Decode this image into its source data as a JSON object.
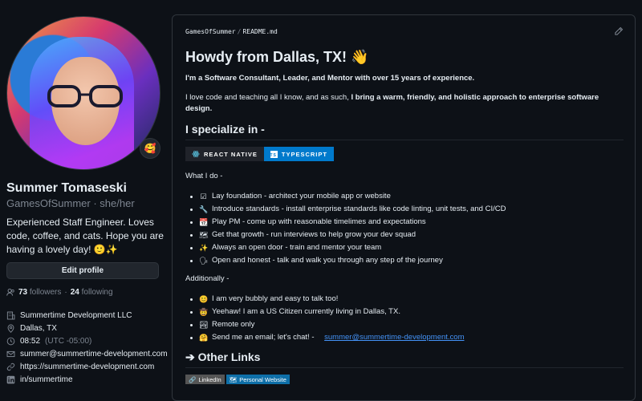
{
  "profile": {
    "name": "Summer Tomaseski",
    "login_line": "GamesOfSummer · she/her",
    "bio": "Experienced Staff Engineer. Loves code, coffee, and cats. Hope you are having a lovely day! 🙂✨",
    "status_emoji": "🥰",
    "edit_label": "Edit profile",
    "followers_count": "73",
    "followers_label": "followers",
    "dot": "·",
    "following_count": "24",
    "following_label": "following",
    "company": "Summertime Development LLC",
    "location": "Dallas, TX",
    "local_time": "08:52",
    "timezone": "(UTC -05:00)",
    "email": "summer@summertime-development.com",
    "website": "https://summertime-development.com",
    "linkedin": "in/summertime"
  },
  "readme": {
    "breadcrumb_repo": "GamesOfSummer",
    "breadcrumb_sep": "/",
    "breadcrumb_file": "README.md",
    "title": "Howdy from Dallas, TX! 👋",
    "intro_bold": "I'm a Software Consultant, Leader, and Mentor with over 15 years of experience.",
    "intro_plain": "I love code and teaching all I know, and as such, ",
    "intro_emph": "I bring a warm, friendly, and holistic approach to enterprise software design.",
    "specialize_heading": "I specialize in -",
    "badges": [
      "REACT NATIVE",
      "TYPESCRIPT"
    ],
    "ts_logo": "TS",
    "what_i_do_label": "What I do -",
    "what_i_do": [
      {
        "emoji": "☑",
        "text": "Lay foundation - architect your mobile app or website"
      },
      {
        "emoji": "🔧",
        "text": "Introduce standards - install enterprise standards like code linting, unit tests, and CI/CD"
      },
      {
        "emoji": "📆",
        "text": "Play PM - come up with reasonable timelimes and expectations"
      },
      {
        "emoji": "🗺",
        "text": "Get that growth - run interviews to help grow your dev squad"
      },
      {
        "emoji": "✨",
        "text": "Always an open door - train and mentor your team"
      },
      {
        "emoji": "🗣",
        "text": "Open and honest - talk and walk you through any step of the journey"
      }
    ],
    "additionally_label": "Additionally -",
    "additionally": [
      {
        "emoji": "😊",
        "text": "I am very bubbly and easy to talk too!"
      },
      {
        "emoji": "🤠",
        "text": "Yeehaw! I am a US Citizen currently living in Dallas, TX."
      },
      {
        "emoji": "🏞",
        "text": "Remote only"
      }
    ],
    "email_item_emoji": "🤗",
    "email_item_text": "Send me an email; let's chat! - ",
    "email_link": "summer@summertime-development.com",
    "other_links_heading": "➔ Other Links",
    "link_badges": [
      {
        "icon": "🔗",
        "label": "LinkedIn"
      },
      {
        "icon": "🗺",
        "label": "Personal Website"
      }
    ]
  },
  "colors": {
    "background": "#0d1117",
    "text": "#e6edf3",
    "muted": "#7d8590",
    "link": "#4493f8",
    "border": "#30363d",
    "typescript_badge": "#007acc",
    "react_badge": "#20232a"
  }
}
